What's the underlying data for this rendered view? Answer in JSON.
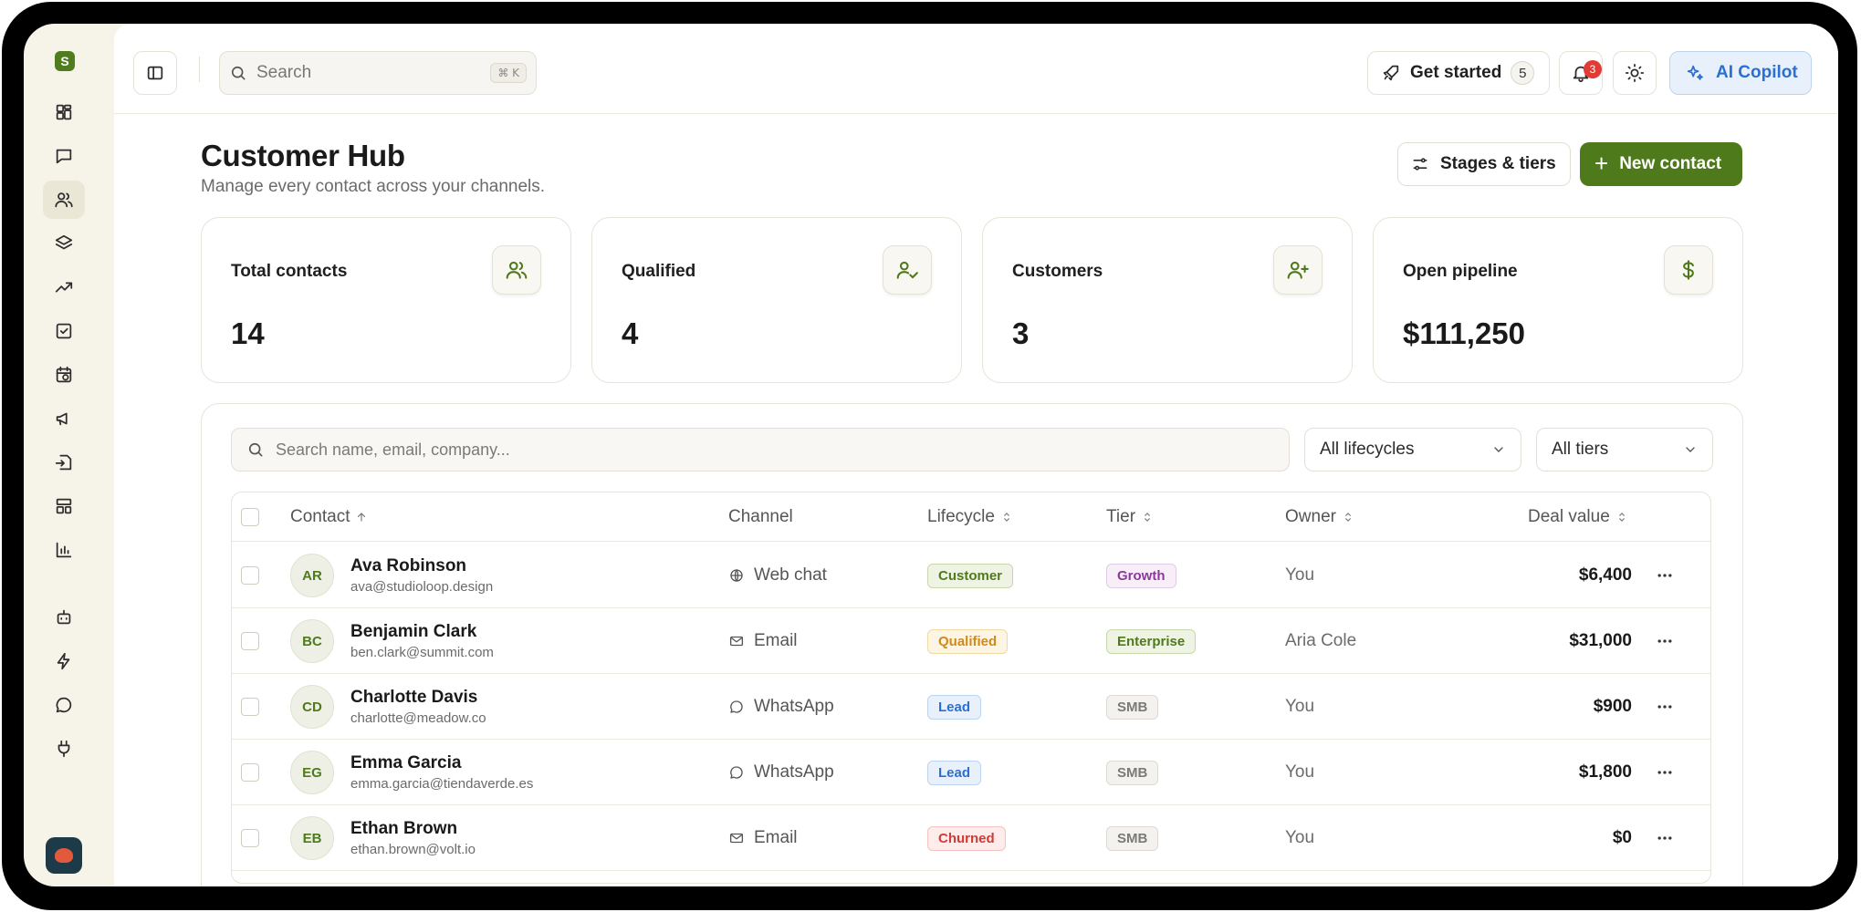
{
  "topbar": {
    "search_placeholder": "Search",
    "search_shortcut": "⌘ K",
    "get_started_label": "Get started",
    "get_started_count": "5",
    "notifications_count": "3",
    "ai_copilot_label": "AI Copilot"
  },
  "page": {
    "title": "Customer Hub",
    "subtitle": "Manage every contact across your channels.",
    "stages_button": "Stages & tiers",
    "new_contact_button": "New contact"
  },
  "stats": [
    {
      "label": "Total contacts",
      "value": "14",
      "icon": "users-icon"
    },
    {
      "label": "Qualified",
      "value": "4",
      "icon": "user-check-icon"
    },
    {
      "label": "Customers",
      "value": "3",
      "icon": "user-plus-icon"
    },
    {
      "label": "Open pipeline",
      "value": "$111,250",
      "icon": "dollar-icon"
    }
  ],
  "table": {
    "search_placeholder": "Search name, email, company...",
    "lifecycle_filter": "All lifecycles",
    "tier_filter": "All tiers",
    "columns": {
      "contact": "Contact",
      "channel": "Channel",
      "lifecycle": "Lifecycle",
      "tier": "Tier",
      "owner": "Owner",
      "deal_value": "Deal value"
    },
    "rows": [
      {
        "initials": "AR",
        "name": "Ava Robinson",
        "email": "ava@studioloop.design",
        "channel": "Web chat",
        "channel_icon": "globe-icon",
        "lifecycle": "Customer",
        "tier": "Growth",
        "owner": "You",
        "deal": "$6,400"
      },
      {
        "initials": "BC",
        "name": "Benjamin Clark",
        "email": "ben.clark@summit.com",
        "channel": "Email",
        "channel_icon": "mail-icon",
        "lifecycle": "Qualified",
        "tier": "Enterprise",
        "owner": "Aria Cole",
        "deal": "$31,000"
      },
      {
        "initials": "CD",
        "name": "Charlotte Davis",
        "email": "charlotte@meadow.co",
        "channel": "WhatsApp",
        "channel_icon": "chat-bubble-icon",
        "lifecycle": "Lead",
        "tier": "SMB",
        "owner": "You",
        "deal": "$900"
      },
      {
        "initials": "EG",
        "name": "Emma Garcia",
        "email": "emma.garcia@tiendaverde.es",
        "channel": "WhatsApp",
        "channel_icon": "chat-bubble-icon",
        "lifecycle": "Lead",
        "tier": "SMB",
        "owner": "You",
        "deal": "$1,800"
      },
      {
        "initials": "EB",
        "name": "Ethan Brown",
        "email": "ethan.brown@volt.io",
        "channel": "Email",
        "channel_icon": "mail-icon",
        "lifecycle": "Churned",
        "tier": "SMB",
        "owner": "You",
        "deal": "$0"
      }
    ]
  },
  "colors": {
    "brand": "#4f7a1c",
    "ai_blue": "#2a6fd1",
    "lifecycle_customer": "#4f7a1c",
    "lifecycle_qualified": "#d18a16",
    "lifecycle_lead": "#2a6fd1",
    "lifecycle_churned": "#d23a35",
    "tier_growth": "#8a3a9a",
    "tier_enterprise": "#4f7a1c",
    "tier_smb": "#7a7a7a"
  }
}
